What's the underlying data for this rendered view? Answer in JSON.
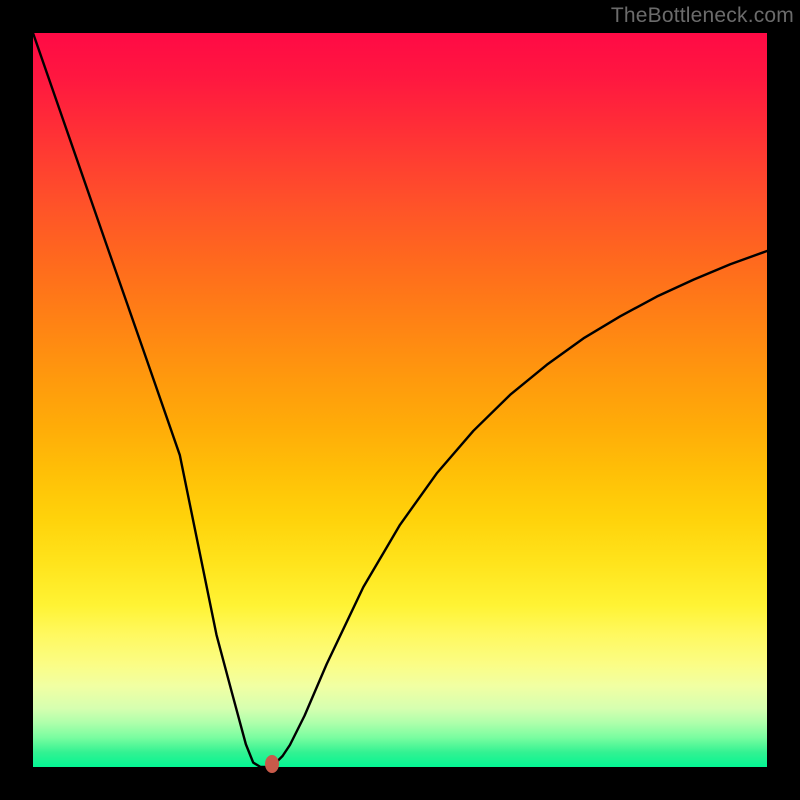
{
  "watermark": "TheBottleneck.com",
  "chart_data": {
    "type": "line",
    "title": "",
    "xlabel": "",
    "ylabel": "",
    "xlim": [
      0,
      100
    ],
    "ylim": [
      0,
      100
    ],
    "grid": false,
    "legend": false,
    "series": [
      {
        "name": "curve",
        "x": [
          0,
          5,
          10,
          15,
          20,
          25,
          27,
          29,
          30,
          31,
          32,
          33,
          34,
          35,
          37,
          40,
          45,
          50,
          55,
          60,
          65,
          70,
          75,
          80,
          85,
          90,
          95,
          100
        ],
        "values": [
          100,
          85.6,
          71.2,
          56.9,
          42.5,
          18.0,
          10.5,
          3.1,
          0.6,
          0.0,
          0.0,
          0.5,
          1.5,
          3.0,
          7.0,
          14.0,
          24.5,
          33.0,
          40.0,
          45.8,
          50.7,
          54.8,
          58.4,
          61.4,
          64.1,
          66.4,
          68.5,
          70.3
        ]
      }
    ],
    "marker": {
      "x": 32.5,
      "y": 0.4,
      "color": "#c85a4a"
    },
    "background_gradient": {
      "direction": "vertical",
      "stops": [
        {
          "pos": 0.0,
          "color": "#ff0a45"
        },
        {
          "pos": 0.5,
          "color": "#ffa108"
        },
        {
          "pos": 0.8,
          "color": "#fff645"
        },
        {
          "pos": 1.0,
          "color": "#03f593"
        }
      ]
    }
  }
}
